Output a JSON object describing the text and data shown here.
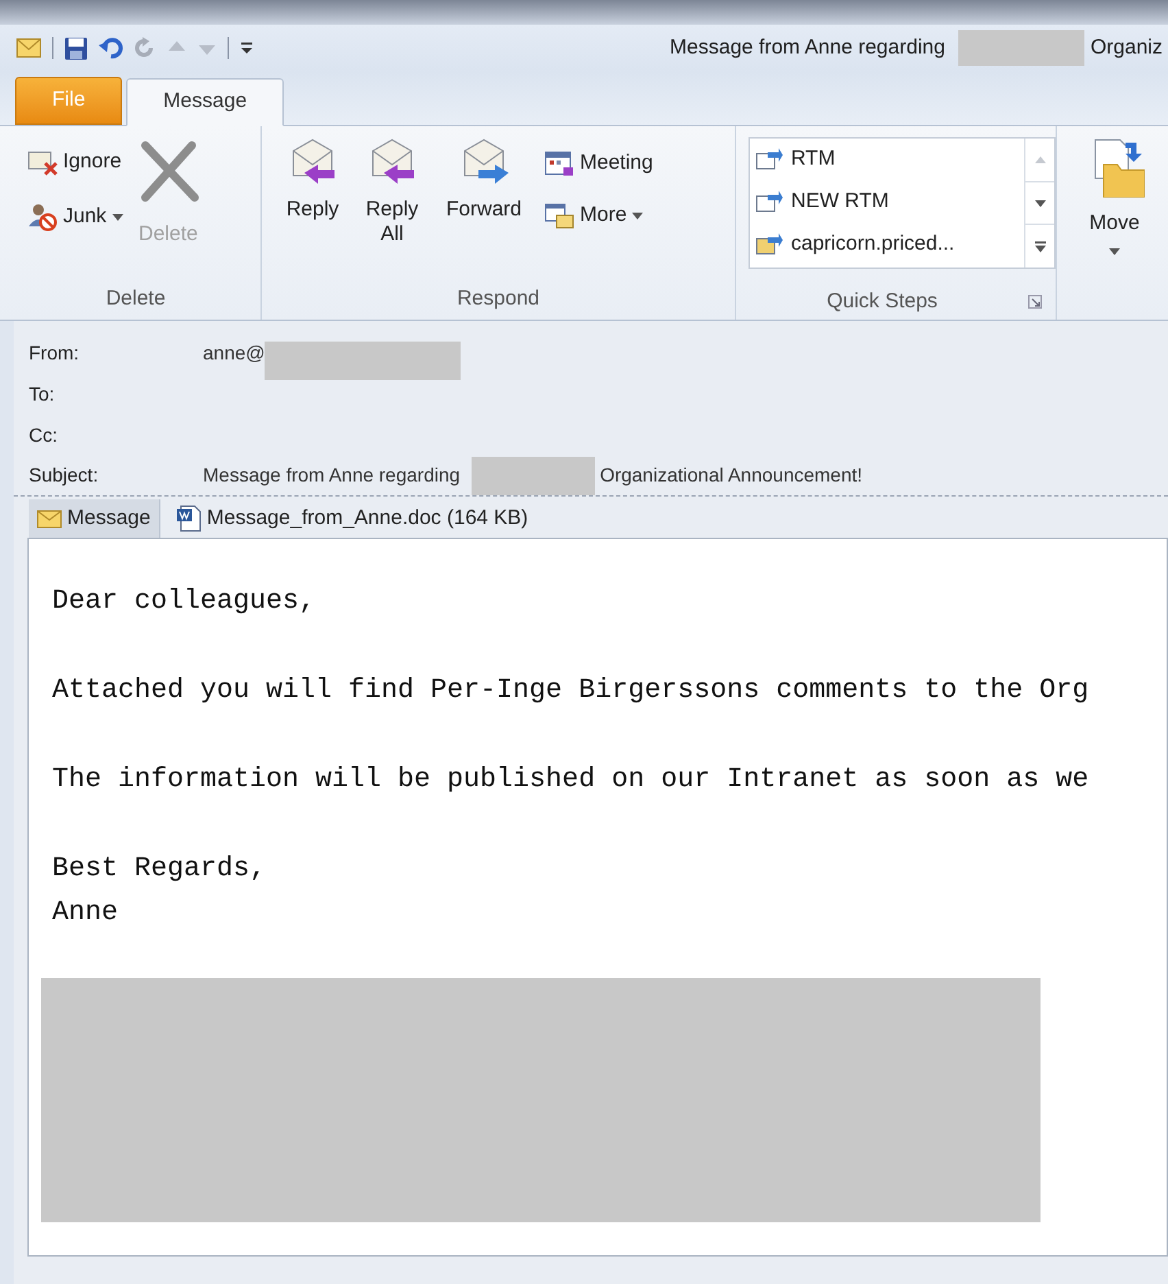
{
  "window": {
    "title_start": "Message from Anne regarding",
    "title_redacted": true,
    "title_end": "Organiz"
  },
  "tabs": [
    {
      "label": "File",
      "kind": "file",
      "selected": false
    },
    {
      "label": "Message",
      "kind": "tab",
      "selected": true
    }
  ],
  "ribbon": {
    "delete_group": {
      "label": "Delete",
      "ignore": {
        "label": "Ignore",
        "disabled": false
      },
      "junk": {
        "label": "Junk",
        "disabled": false
      },
      "delete": {
        "label": "Delete",
        "disabled": true
      }
    },
    "respond_group": {
      "label": "Respond",
      "reply": "Reply",
      "reply_all": "Reply All",
      "forward": "Forward",
      "meeting": "Meeting",
      "more": "More"
    },
    "quick_steps": {
      "label": "Quick Steps",
      "items": [
        {
          "label": "RTM"
        },
        {
          "label": "NEW RTM"
        },
        {
          "label": "capricorn.priced..."
        }
      ]
    },
    "move": {
      "label": "Move"
    }
  },
  "header": [
    {
      "label": "From:",
      "value": "anne@",
      "redacted": true
    },
    {
      "label": "To:",
      "redacted": false
    },
    {
      "label": "Cc:",
      "redacted": false
    },
    {
      "label": "Subject:",
      "value": "Message from Anne regarding",
      "redacted": true,
      "value_end": "Organizational Announcement!"
    }
  ],
  "attachments": [
    {
      "label": "Message",
      "kind": "message",
      "selected": true
    },
    {
      "label": "Message_from_Anne.doc (164 KB)",
      "kind": "file",
      "selected": false
    }
  ],
  "body": {
    "paragraphs": [
      [
        "Dear colleagues,"
      ],
      [
        "Attached you will find Per-Inge Birgerssons comments to the Org"
      ],
      [
        "The information will be published on our Intranet as soon as we"
      ],
      [
        "Best Regards,",
        "Anne"
      ]
    ],
    "redacted_signature": true
  }
}
